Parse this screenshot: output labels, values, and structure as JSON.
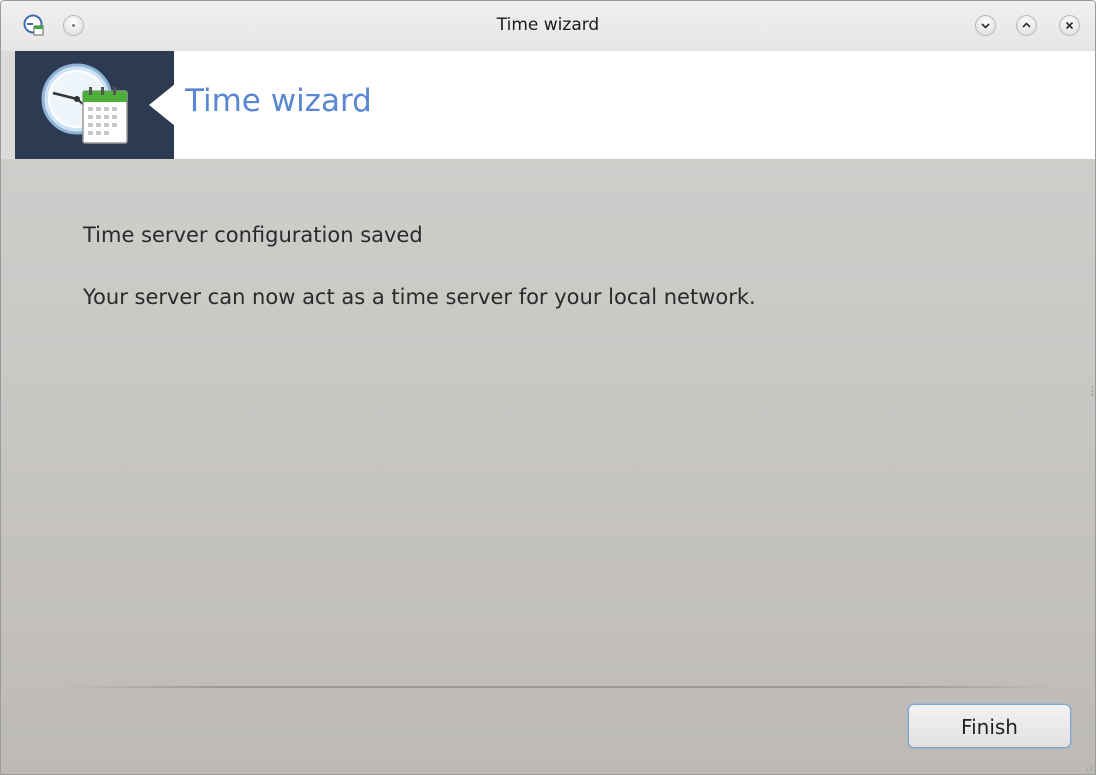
{
  "window": {
    "title": "Time wizard"
  },
  "titlebar": {
    "left_icons": [
      "app-menu-icon",
      "pin-icon"
    ],
    "right_buttons": [
      "minimize-icon",
      "maximize-icon",
      "close-icon"
    ]
  },
  "header": {
    "title": "Time wizard",
    "icon": "clock-calendar-icon",
    "title_color": "#5a87d2",
    "banner_color": "#2c3a52"
  },
  "content": {
    "heading": "Time server configuration saved",
    "message": "Your server can now act as a time server for your local network."
  },
  "footer": {
    "finish_label": "Finish"
  }
}
